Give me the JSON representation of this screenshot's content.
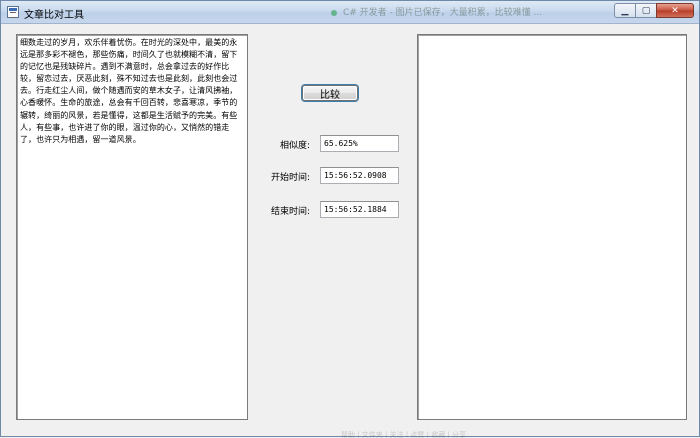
{
  "window": {
    "title": "文章比对工具",
    "minimize_label": "▁",
    "maximize_label": "▢",
    "close_label": "✕",
    "background_ghost": "C# 开发者 - 图片已保存，大量积累，比较难懂 ..."
  },
  "left_panel": {
    "text": "细数走过的岁月，欢乐伴着忧伤。在时光的深处中，最美的永远是那多彩不褪色，那些伤痛，时间久了也就模糊不清，留下的记忆也是残缺碎片。遇到不满意时，总会拿过去的好作比较，留恋过去，厌恶此刻，殊不知过去也是此刻，此刻也会过去。行走红尘人间，做个随遇而安的草木女子，让清风拂袖，心香暖怀。生命的旅途，总会有千回百转，悲喜寒凉，季节的辗转，绮丽的风景，若是懂得，这都是生活赋予的完美。有些人，有些事，也许进了你的眼，温过你的心，又悄然的错走了，也许只为相遇，留一道风景。"
  },
  "right_panel": {
    "text": ""
  },
  "controls": {
    "compare_button_label": "比较",
    "similarity_label": "相似度:",
    "similarity_value": "65.625%",
    "start_time_label": "开始时间:",
    "start_time_value": "15:56:52.0908",
    "end_time_label": "结束时间:",
    "end_time_value": "15:56:52.1884"
  },
  "bottom_ghost": "帮助 | 文件夹 | 关注 | 点赞 | 收藏 | 分享"
}
